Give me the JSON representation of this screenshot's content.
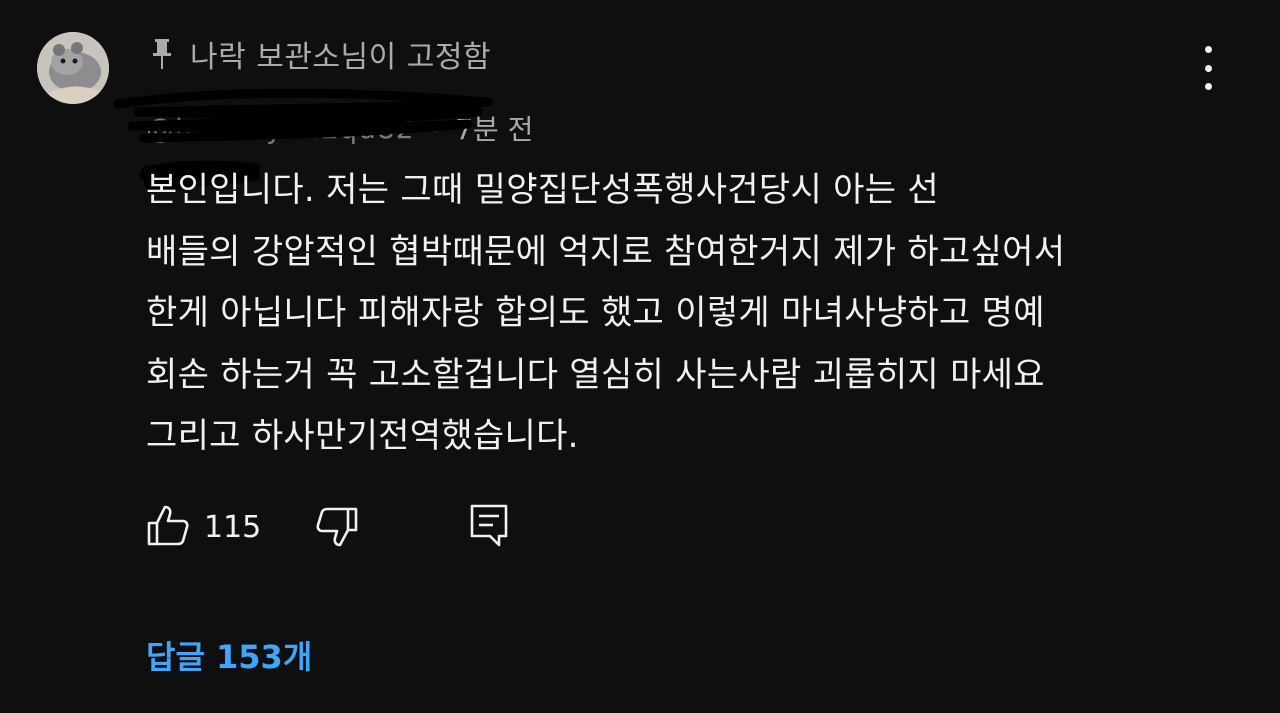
{
  "pinned_label": "나락 보관소님이 고정함",
  "author": {
    "handle": "@inse...yen2qd82",
    "separator": "•",
    "time": "7분 전"
  },
  "comment_text": "본인입니다. 저는 그때 밀양집단성폭행사건당시 아는 선\n배들의 강압적인 협박때문에 억지로 참여한거지 제가 하고싶어서\n한게 아닙니다 피해자랑 합의도 했고 이렇게 마녀사냥하고 명예\n회손 하는거 꼭 고소할겁니다 열심히 사는사람 괴롭히지 마세요\n그리고 하사만기전역했습니다.",
  "likes": "115",
  "replies_label": "답글 153개",
  "icons": {
    "pin": "pin-icon",
    "more": "more-vert-icon",
    "like": "thumbs-up-icon",
    "dislike": "thumbs-down-icon",
    "reply": "reply-icon"
  },
  "colors": {
    "background": "#0f0f0f",
    "text": "#f1f1f1",
    "secondary": "#aaaaaa",
    "link": "#3ea6ff"
  }
}
